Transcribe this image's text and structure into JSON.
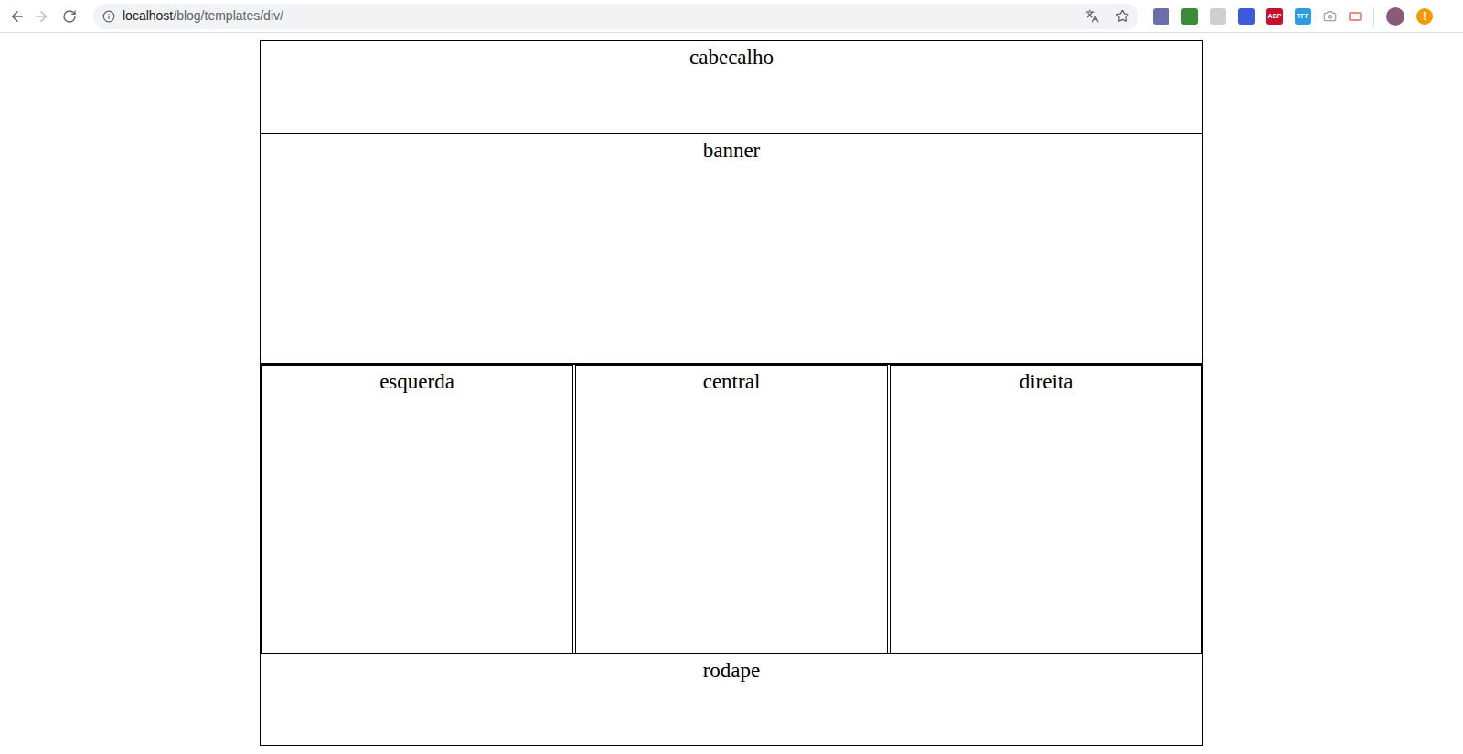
{
  "browser": {
    "url_host": "localhost",
    "url_path": "/blog/templates/div/",
    "extensions": [
      {
        "label": "",
        "color": "#6b6fa8"
      },
      {
        "label": "",
        "color": "#3a8a3a"
      },
      {
        "label": "",
        "color": "#cfcfcf"
      },
      {
        "label": "",
        "color": "#3b5bdb"
      },
      {
        "label": "ABP",
        "color": "#c8102e"
      },
      {
        "label": "TFF",
        "color": "#2f9be6"
      }
    ],
    "alert": "!"
  },
  "layout": {
    "header": "cabecalho",
    "banner": "banner",
    "columns": [
      "esquerda",
      "central",
      "direita"
    ],
    "footer": "rodape"
  }
}
